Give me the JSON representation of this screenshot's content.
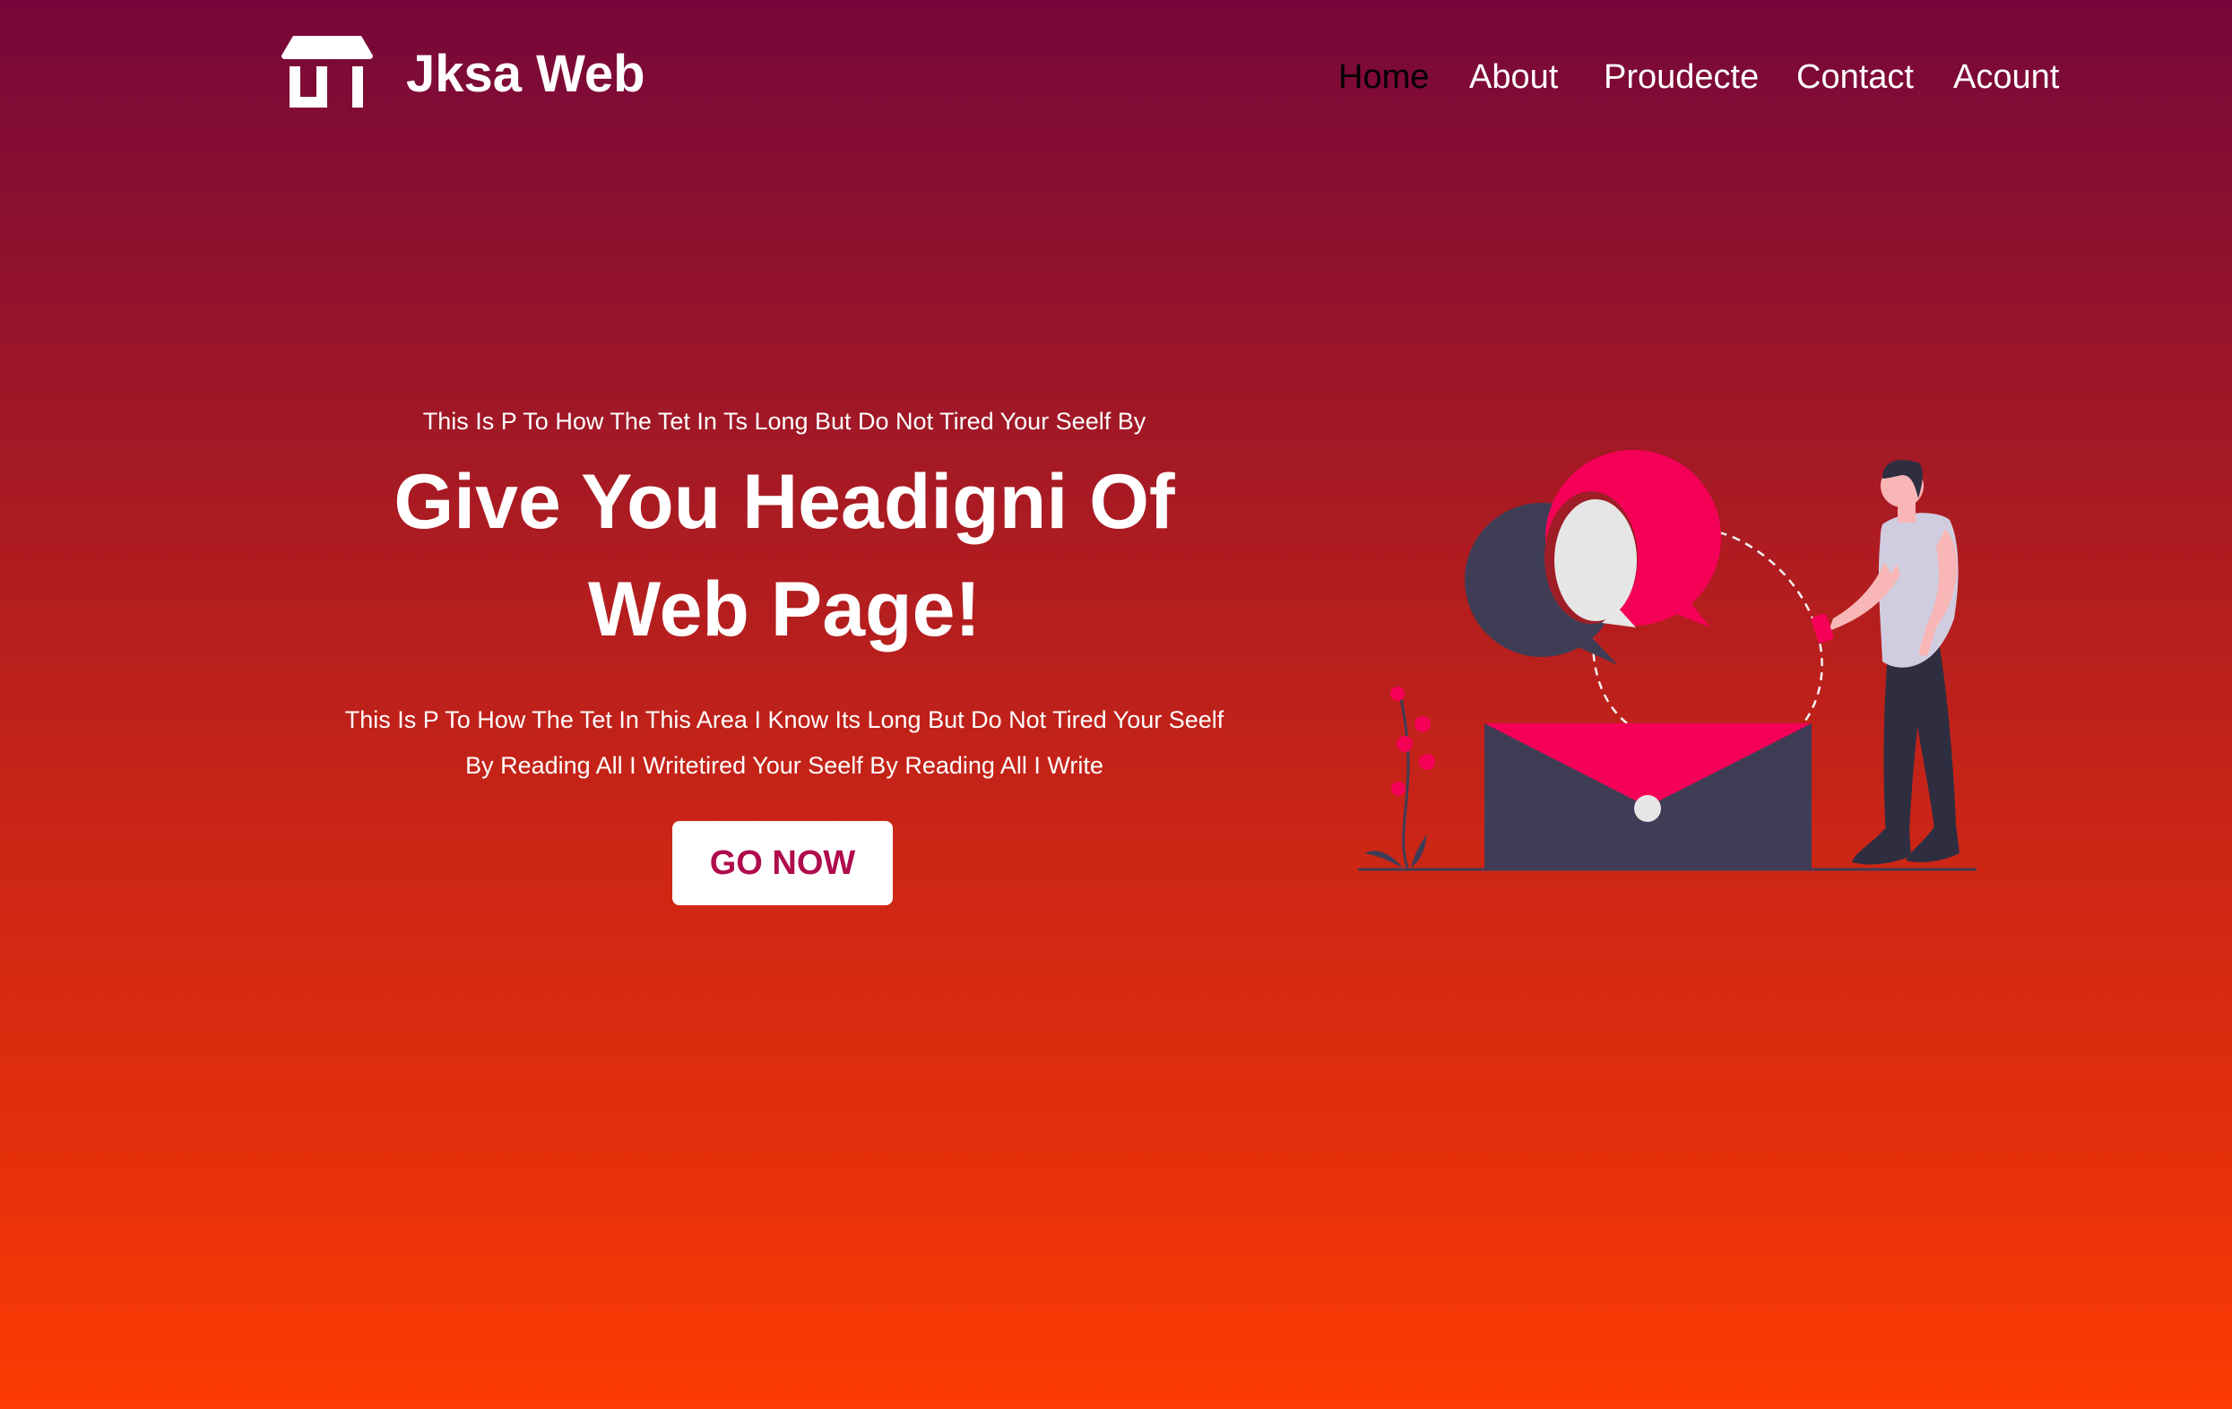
{
  "header": {
    "brand": "Jksa Web",
    "logo_icon": "storefront-icon"
  },
  "nav": {
    "items": [
      {
        "label": "Home",
        "active": true
      },
      {
        "label": "About",
        "active": false
      },
      {
        "label": "Proudecte",
        "active": false
      },
      {
        "label": "Contact",
        "active": false
      },
      {
        "label": "Acount",
        "active": false
      }
    ]
  },
  "hero": {
    "kicker": "This Is P To How The Tet In Ts Long But Do Not Tired Your Seelf By",
    "title_line1": "Give You Headigni Of",
    "title_line2": "Web Page!",
    "body_line1": "This Is P To How The Tet In This Area I Know Its Long But Do Not Tired Your Seelf",
    "body_line2": "By Reading All I Writetired Your Seelf By Reading All I Write",
    "cta_label": "GO NOW"
  },
  "illustration": {
    "subject": "person-with-phone-messages-envelope-illustration"
  },
  "colors": {
    "gradient_top": "#76073a",
    "gradient_bottom": "#fe3b02",
    "accent_pink": "#f50057",
    "dark_slate": "#3f3d56",
    "cta_text": "#b00c4d",
    "active_nav": "#000000"
  }
}
